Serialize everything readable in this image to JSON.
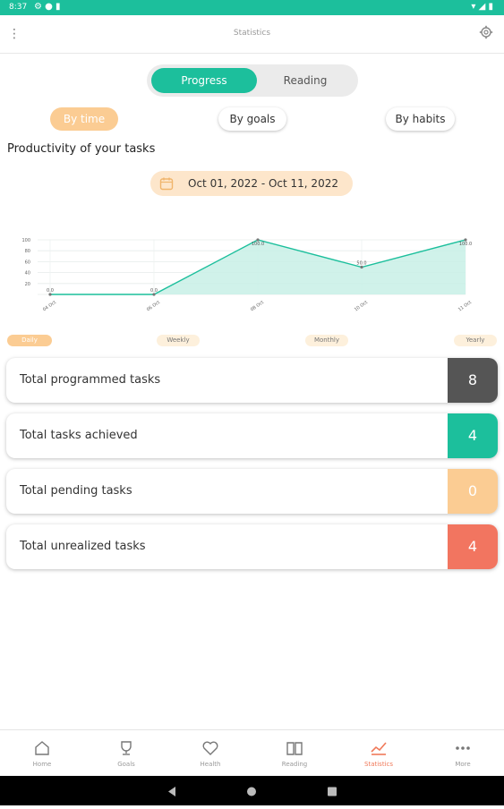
{
  "status_bar": {
    "time": "8:37"
  },
  "app_bar": {
    "title": "Statistics"
  },
  "segment": {
    "progress": "Progress",
    "reading": "Reading"
  },
  "filters": {
    "by_time": "By time",
    "by_goals": "By goals",
    "by_habits": "By habits"
  },
  "section_title": "Productivity of your tasks",
  "date_range": "Oct 01, 2022 - Oct 11, 2022",
  "chart_data": {
    "type": "area",
    "x": [
      "04 Oct",
      "06 Oct",
      "08 Oct",
      "10 Oct",
      "11 Oct"
    ],
    "values": [
      0,
      0,
      100,
      50,
      100
    ],
    "data_labels": [
      "0.0",
      "0.0",
      "100.0",
      "50.0",
      "100.0"
    ],
    "y_ticks": [
      "100",
      "80",
      "60",
      "40",
      "20"
    ],
    "ylim": [
      0,
      100
    ],
    "color": "#1cbf9c",
    "fill": "#c8f0e6",
    "grid": true
  },
  "periods": [
    "Daily",
    "Weekly",
    "Monthly",
    "Yearly"
  ],
  "active_period": "Daily",
  "stats": [
    {
      "label": "Total programmed tasks",
      "value": "8",
      "color": "#555555"
    },
    {
      "label": "Total tasks achieved",
      "value": "4",
      "color": "#1cbf9c"
    },
    {
      "label": "Total pending tasks",
      "value": "0",
      "color": "#fbcc93"
    },
    {
      "label": "Total unrealized tasks",
      "value": "4",
      "color": "#f27560"
    }
  ],
  "bottom_nav": [
    {
      "label": "Home",
      "icon": "home-icon"
    },
    {
      "label": "Goals",
      "icon": "trophy-icon"
    },
    {
      "label": "Health",
      "icon": "heart-icon"
    },
    {
      "label": "Reading",
      "icon": "book-icon"
    },
    {
      "label": "Statistics",
      "icon": "chart-icon",
      "active": true
    },
    {
      "label": "More",
      "icon": "more-icon"
    }
  ],
  "colors": {
    "accent": "#1cbf9c",
    "peach": "#fbcc93",
    "active_nav": "#f07a5a"
  }
}
